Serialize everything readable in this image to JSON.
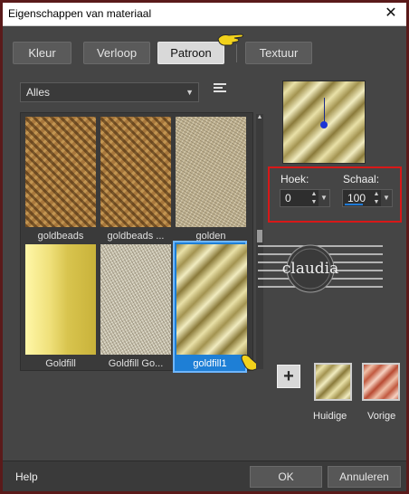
{
  "window": {
    "title": "Eigenschappen van materiaal",
    "close_glyph": "✕"
  },
  "tabs": [
    {
      "label": "Kleur"
    },
    {
      "label": "Verloop"
    },
    {
      "label": "Patroon",
      "active": true
    },
    {
      "label": "Textuur"
    }
  ],
  "category": {
    "selected": "Alles"
  },
  "patterns": [
    {
      "label": "goldbeads"
    },
    {
      "label": "goldbeads ..."
    },
    {
      "label": "golden"
    },
    {
      "label": "Goldfill"
    },
    {
      "label": "Goldfill Go..."
    },
    {
      "label": "goldfill1",
      "selected": true
    }
  ],
  "controls": {
    "angle": {
      "label": "Hoek:",
      "value": "0"
    },
    "scale": {
      "label": "Schaal:",
      "value": "100"
    }
  },
  "swatches": {
    "current_label": "Huidige",
    "previous_label": "Vorige"
  },
  "footer": {
    "help": "Help",
    "ok": "OK",
    "cancel": "Annuleren"
  },
  "watermark": {
    "text": "claudia"
  },
  "colors": {
    "highlight_border": "#d81818",
    "selection": "#1e7fd6"
  }
}
